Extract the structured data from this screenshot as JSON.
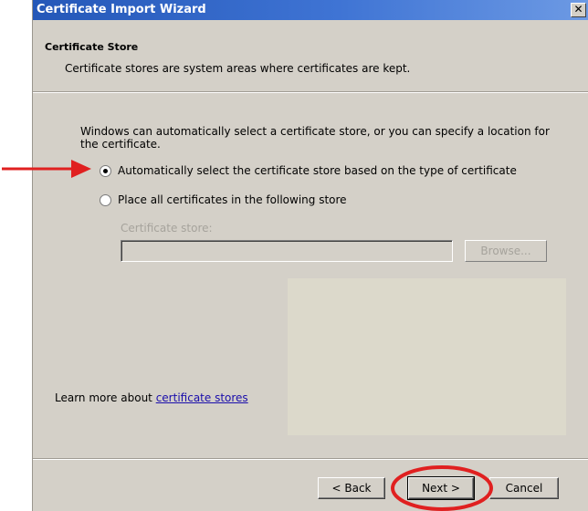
{
  "window": {
    "title": "Certificate Import Wizard",
    "close_glyph": "✕"
  },
  "header": {
    "title": "Certificate Store",
    "description": "Certificate stores are system areas where certificates are kept."
  },
  "body": {
    "intro": "Windows can automatically select a certificate store, or you can specify a location for the certificate.",
    "options": [
      {
        "label": "Automatically select the certificate store based on the type of certificate",
        "selected": true
      },
      {
        "label": "Place all certificates in the following store",
        "selected": false
      }
    ],
    "store_label": "Certificate store:",
    "store_value": "",
    "browse_label": "Browse...",
    "learn_more_prefix": "Learn more about ",
    "learn_more_link": "certificate stores"
  },
  "footer": {
    "back_label": "< Back",
    "next_label": "Next >",
    "cancel_label": "Cancel"
  },
  "annotations": {
    "color": "#e02020",
    "arrow_target": "automatic-option",
    "circle_target": "next-button"
  },
  "colors": {
    "titlebar": "#2457b8",
    "dialog_bg": "#d4d0c8",
    "disabled_text": "#a6a39c",
    "link": "#1a0dab"
  }
}
